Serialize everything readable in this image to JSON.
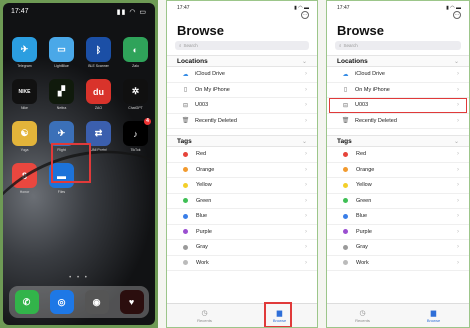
{
  "home": {
    "time": "17:47",
    "apps": [
      {
        "icon": "telegram-icon",
        "label": "Telegram",
        "color": "#2b9ee0",
        "glyph": "✈"
      },
      {
        "icon": "chat-icon",
        "label": "LightBlue",
        "color": "#4aa8e8",
        "glyph": "▭"
      },
      {
        "icon": "bluetooth-icon",
        "label": "BLE Scanner",
        "color": "#1b4fa6",
        "glyph": "ᛒ"
      },
      {
        "icon": "leaf-icon",
        "label": "Zalo",
        "color": "#2fa35a",
        "glyph": "◐"
      },
      {
        "icon": "nike-icon",
        "label": "Nike",
        "color": "#111111",
        "glyph": "NIKE"
      },
      {
        "icon": "chart-icon",
        "label": "Nettra",
        "color": "#101a0c",
        "glyph": "▞"
      },
      {
        "icon": "du-icon",
        "label": "ZAO",
        "color": "#d9332b",
        "glyph": "du"
      },
      {
        "icon": "openai-icon",
        "label": "ChatGPT",
        "color": "#101010",
        "glyph": "✲"
      },
      {
        "icon": "app-icon",
        "label": "Yoga",
        "color": "#e3b43a",
        "glyph": "☯"
      },
      {
        "icon": "app2-icon",
        "label": "Flight",
        "color": "#3b70b8",
        "glyph": "✈"
      },
      {
        "icon": "connect-icon",
        "label": "UNI Portal",
        "color": "#3b5fae",
        "glyph": "⇄"
      },
      {
        "icon": "tiktok-icon",
        "label": "TikTok",
        "color": "#000000",
        "glyph": "♪",
        "badge": "4"
      },
      {
        "icon": "honor-icon",
        "label": "Honor",
        "color": "#e9473f",
        "glyph": "8"
      },
      {
        "icon": "files-icon",
        "label": "Files",
        "color": "#1d73d9",
        "glyph": "▬"
      }
    ],
    "dock": [
      {
        "icon": "phone-icon",
        "color": "#32b44a",
        "glyph": "✆"
      },
      {
        "icon": "safari-icon",
        "color": "#1e78e6",
        "glyph": "◎"
      },
      {
        "icon": "camera-icon",
        "color": "#555555",
        "glyph": "◉"
      },
      {
        "icon": "heart-monitor-icon",
        "color": "#2b0e0e",
        "glyph": "♥"
      }
    ],
    "page_dots": "• • •"
  },
  "files": {
    "time": "17:47",
    "title": "Browse",
    "search_placeholder": "Search",
    "locations_header": "Locations",
    "locations": [
      {
        "icon": "cloud-icon",
        "glyph": "☁",
        "label": "iCloud Drive",
        "color": "#3a8ee6"
      },
      {
        "icon": "phone-icon",
        "glyph": "▯",
        "label": "On My iPhone",
        "color": "#666666"
      },
      {
        "icon": "drive-icon",
        "glyph": "⊟",
        "label": "U003",
        "color": "#666666"
      },
      {
        "icon": "trash-icon",
        "glyph": "🗑",
        "label": "Recently Deleted",
        "color": "#666666"
      }
    ],
    "tags_header": "Tags",
    "tags": [
      {
        "label": "Red",
        "color": "#e6443a"
      },
      {
        "label": "Orange",
        "color": "#f29a2e"
      },
      {
        "label": "Yellow",
        "color": "#f3cf2a"
      },
      {
        "label": "Green",
        "color": "#3fbf55"
      },
      {
        "label": "Blue",
        "color": "#3a7ee8"
      },
      {
        "label": "Purple",
        "color": "#9a4fd0"
      },
      {
        "label": "Gray",
        "color": "#9a9a9a"
      },
      {
        "label": "Work",
        "color": "#bbbbbb"
      }
    ],
    "tab_recents": "Recents",
    "tab_browse": "Browse"
  },
  "colors": {
    "highlight": "#e03a3a",
    "accent": "#2f6fd8",
    "border": "#9cc68a"
  }
}
